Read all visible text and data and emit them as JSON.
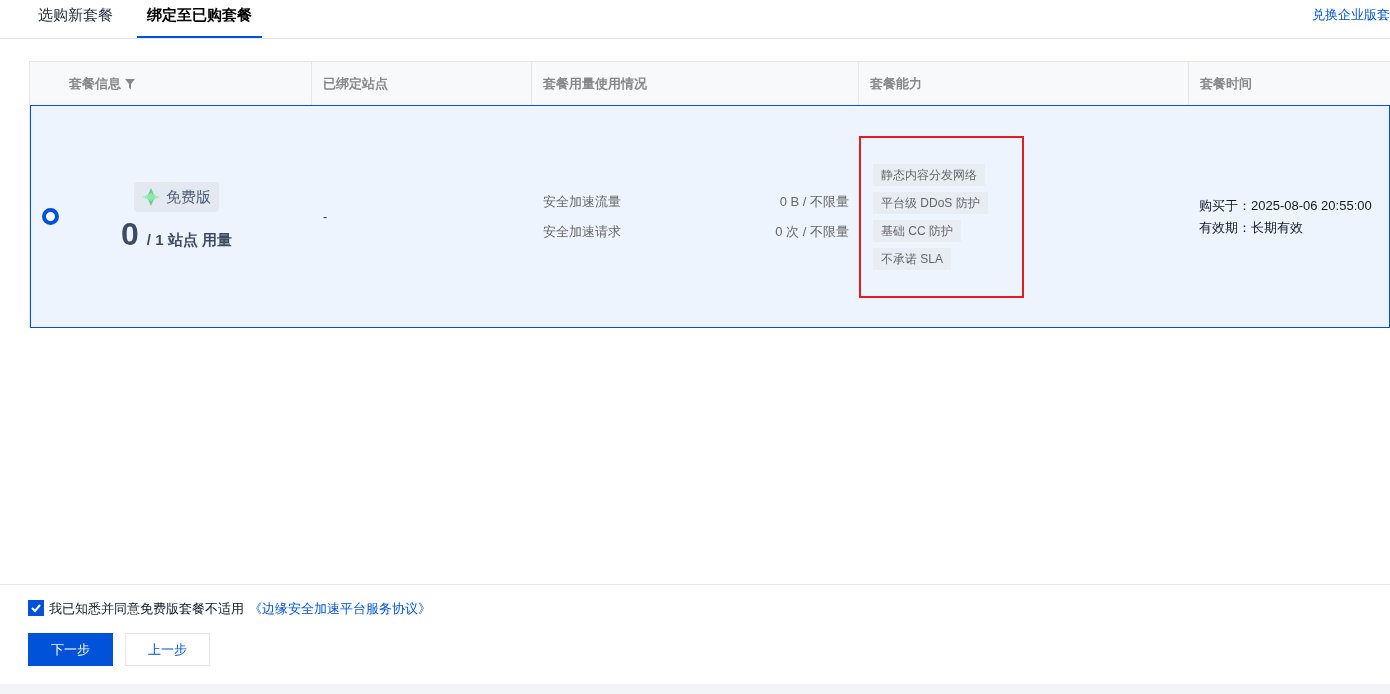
{
  "tabs": [
    {
      "label": "选购新套餐",
      "selected": false
    },
    {
      "label": "绑定至已购套餐",
      "selected": true
    }
  ],
  "redeem_link": "兑换企业版套",
  "table": {
    "columns": [
      {
        "label": "套餐信息",
        "filter": true
      },
      {
        "label": "已绑定站点",
        "filter": false
      },
      {
        "label": "套餐用量使用情况",
        "filter": false
      },
      {
        "label": "套餐能力",
        "filter": false
      },
      {
        "label": "套餐时间",
        "filter": false
      }
    ],
    "rows": [
      {
        "selected": true,
        "plan_badge": "免费版",
        "used": "0",
        "quota": "/ 1 站点 用量",
        "bound_site": "-",
        "usage": [
          {
            "label": "安全加速流量",
            "value": "0 B / 不限量"
          },
          {
            "label": "安全加速请求",
            "value": "0 次 / 不限量"
          }
        ],
        "capabilities_highlighted": true,
        "capabilities": [
          "静态内容分发网络",
          "平台级 DDoS 防护",
          "基础 CC 防护",
          "不承诺 SLA"
        ],
        "time": [
          "购买于：2025-08-06 20:55:00",
          "有效期：长期有效"
        ]
      }
    ]
  },
  "agreement": {
    "checked": true,
    "text": "我已知悉并同意免费版套餐不适用",
    "link": "《边缘安全加速平台服务协议》"
  },
  "buttons": [
    {
      "label": "下一步",
      "kind": "primary"
    },
    {
      "label": "上一步",
      "kind": "secondary"
    }
  ]
}
